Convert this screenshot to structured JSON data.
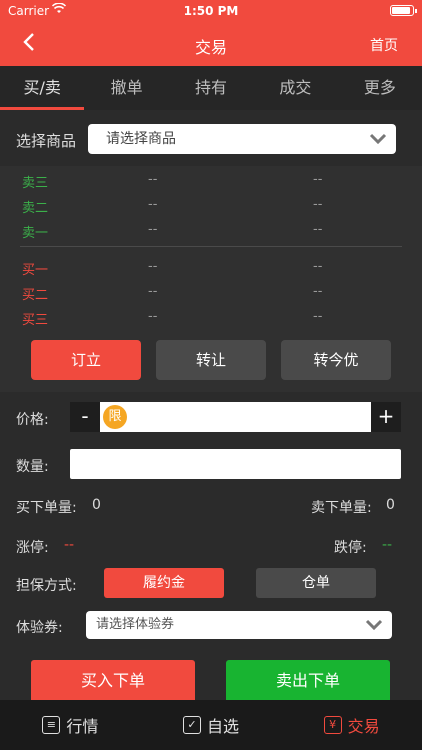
{
  "status_bar": {
    "carrier": "Carrier",
    "time": "1:50 PM"
  },
  "nav": {
    "back_icon": "chevron-left-icon",
    "title": "交易",
    "home": "首页"
  },
  "tabs": [
    {
      "label": "买/卖",
      "active": true
    },
    {
      "label": "撤单"
    },
    {
      "label": "持有"
    },
    {
      "label": "成交"
    },
    {
      "label": "更多"
    }
  ],
  "product_select": {
    "label": "选择商品",
    "placeholder": "请选择商品"
  },
  "quotes": {
    "sell": [
      {
        "label": "卖三",
        "price": "--",
        "volume": "--"
      },
      {
        "label": "卖二",
        "price": "--",
        "volume": "--"
      },
      {
        "label": "卖一",
        "price": "--",
        "volume": "--"
      }
    ],
    "buy": [
      {
        "label": "买一",
        "price": "--",
        "volume": "--"
      },
      {
        "label": "买二",
        "price": "--",
        "volume": "--"
      },
      {
        "label": "买三",
        "price": "--",
        "volume": "--"
      }
    ]
  },
  "actions": {
    "order": "订立",
    "transfer": "转让",
    "transfer_today": "转今优"
  },
  "price": {
    "label": "价格:",
    "minus": "-",
    "plus": "+",
    "limit_badge": "限"
  },
  "quantity": {
    "label": "数量:"
  },
  "buy_qty": {
    "label": "买下单量:",
    "value": "0"
  },
  "sell_qty": {
    "label": "卖下单量:",
    "value": "0"
  },
  "limit_up": {
    "label": "涨停:",
    "value": "--"
  },
  "limit_down": {
    "label": "跌停:",
    "value": "--"
  },
  "guarantee": {
    "label": "担保方式:",
    "option_deposit": "履约金",
    "option_warehouse": "仓单"
  },
  "coupon": {
    "label": "体验券:",
    "placeholder": "请选择体验券"
  },
  "order_buttons": {
    "buy": "买入下单",
    "sell": "卖出下单"
  },
  "tabbar": [
    {
      "label": "行情",
      "icon": "market-icon"
    },
    {
      "label": "自选",
      "icon": "checkbox-icon"
    },
    {
      "label": "交易",
      "icon": "trade-icon",
      "active": true
    }
  ],
  "colors": {
    "accent": "#f14a3e",
    "buy_green": "#18b431",
    "sell_label_green": "#3bb04a"
  }
}
